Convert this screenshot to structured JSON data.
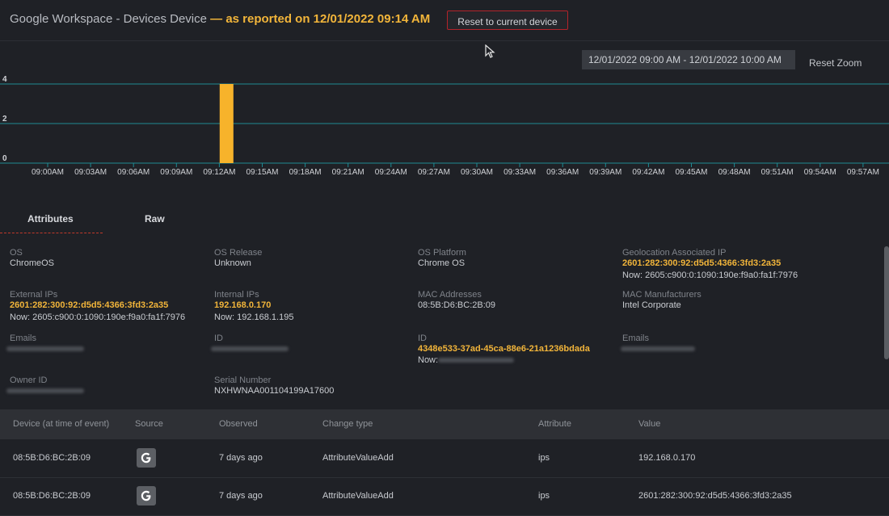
{
  "header": {
    "title": "Google Workspace - Devices Device",
    "title_accent": "— as reported on 12/01/2022 09:14 AM",
    "reset_button": "Reset to current device"
  },
  "chart_controls": {
    "date_range": "12/01/2022 09:00 AM - 12/01/2022 10:00 AM",
    "reset_zoom": "Reset Zoom"
  },
  "chart_data": {
    "type": "bar",
    "x_start_min": 0,
    "x_end_min": 60,
    "ylim": [
      0,
      4
    ],
    "y_ticks": [
      0,
      2,
      4
    ],
    "x_tick_labels": [
      "09:00AM",
      "09:03AM",
      "09:06AM",
      "09:09AM",
      "09:12AM",
      "09:15AM",
      "09:18AM",
      "09:21AM",
      "09:24AM",
      "09:27AM",
      "09:30AM",
      "09:33AM",
      "09:36AM",
      "09:39AM",
      "09:42AM",
      "09:45AM",
      "09:48AM",
      "09:51AM",
      "09:54AM",
      "09:57AM"
    ],
    "bars": [
      {
        "time": "09:14AM",
        "value": 4
      }
    ],
    "bar_color": "#f7b32b",
    "grid_color": "#1f8a93"
  },
  "tabs": {
    "attributes": "Attributes",
    "raw": "Raw"
  },
  "attributes": {
    "os": {
      "label": "OS",
      "value": "ChromeOS"
    },
    "os_release": {
      "label": "OS Release",
      "value": "Unknown"
    },
    "os_platform": {
      "label": "OS Platform",
      "value": "Chrome OS"
    },
    "geo_ip": {
      "label": "Geolocation Associated IP",
      "value": "2601:282:300:92:d5d5:4366:3fd3:2a35",
      "now": "Now: 2605:c900:0:1090:190e:f9a0:fa1f:7976"
    },
    "external_ips": {
      "label": "External IPs",
      "value": "2601:282:300:92:d5d5:4366:3fd3:2a35",
      "now": "Now: 2605:c900:0:1090:190e:f9a0:fa1f:7976"
    },
    "internal_ips": {
      "label": "Internal IPs",
      "value": "192.168.0.170",
      "now": "Now: 192.168.1.195"
    },
    "mac_addresses": {
      "label": "MAC Addresses",
      "value": "08:5B:D6:BC:2B:09"
    },
    "mac_manufacturers": {
      "label": "MAC Manufacturers",
      "value": "Intel Corporate"
    },
    "emails_1": {
      "label": "Emails"
    },
    "id_1": {
      "label": "ID"
    },
    "id_2": {
      "label": "ID",
      "value": "4348e533-37ad-45ca-88e6-21a1236bdada",
      "now": "Now:"
    },
    "emails_2": {
      "label": "Emails"
    },
    "owner_id": {
      "label": "Owner ID"
    },
    "serial_number": {
      "label": "Serial Number",
      "value": "NXHWNAA001104199A17600"
    }
  },
  "table": {
    "columns": [
      "Device (at time of event)",
      "Source",
      "Observed",
      "Change type",
      "Attribute",
      "Value"
    ],
    "rows": [
      {
        "device": "08:5B:D6:BC:2B:09",
        "source_icon": "google-icon",
        "observed": "7 days ago",
        "change_type": "AttributeValueAdd",
        "attribute": "ips",
        "value": "192.168.0.170"
      },
      {
        "device": "08:5B:D6:BC:2B:09",
        "source_icon": "google-icon",
        "observed": "7 days ago",
        "change_type": "AttributeValueAdd",
        "attribute": "ips",
        "value": "2601:282:300:92:d5d5:4366:3fd3:2a35"
      }
    ]
  }
}
